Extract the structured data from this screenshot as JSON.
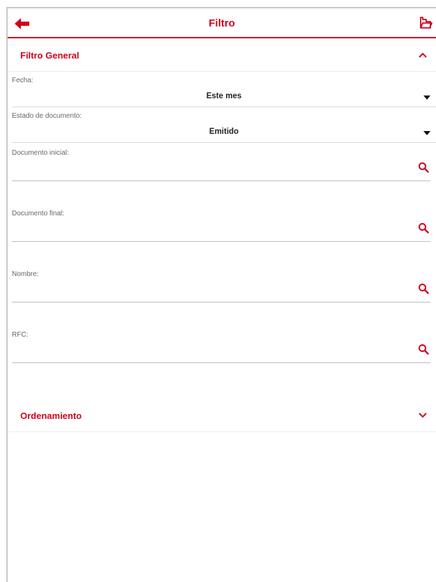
{
  "header": {
    "title": "Filtro",
    "back_icon": "arrow-left-icon",
    "action_icon": "folder-open-icon"
  },
  "colors": {
    "accent": "#d0021b",
    "text": "#212121",
    "label": "#666666",
    "divider": "#d9d9d9"
  },
  "general_filter": {
    "title": "Filtro General",
    "expanded": true,
    "date": {
      "label": "Fecha:",
      "value": "Este mes"
    },
    "document_status": {
      "label": "Estado de documento:",
      "value": "Emitido"
    },
    "initial_document": {
      "label": "Documento inicial:",
      "value": ""
    },
    "final_document": {
      "label": "Documento final:",
      "value": ""
    },
    "name": {
      "label": "Nombre:",
      "value": ""
    },
    "rfc": {
      "label": "RFC:",
      "value": ""
    }
  },
  "sorting": {
    "title": "Ordenamiento",
    "expanded": false
  }
}
